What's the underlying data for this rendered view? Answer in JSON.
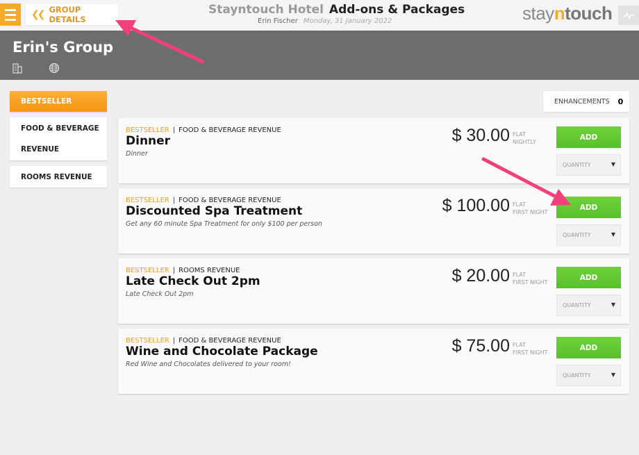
{
  "topbar": {
    "back_label": "GROUP DETAILS",
    "hotel_name": "Stayntouch Hotel",
    "page_title": "Add-ons & Packages",
    "user_name": "Erin Fischer",
    "date": "Monday, 31 January 2022",
    "logo": {
      "part1": "stay",
      "part2": "n",
      "part3": "touch"
    }
  },
  "header": {
    "group_name": "Erin's Group",
    "icons": [
      "building-icon",
      "globe-icon"
    ]
  },
  "sidebar": {
    "items": [
      {
        "label": "BESTSELLER",
        "active": true
      },
      {
        "label_line1": "FOOD & BEVERAGE",
        "label_line2": "REVENUE",
        "active": false
      },
      {
        "label": "ROOMS REVENUE",
        "active": false
      }
    ]
  },
  "enhancements": {
    "label": "ENHANCEMENTS",
    "count": "0"
  },
  "addons": [
    {
      "category": "BESTSELLER",
      "revenue": "FOOD & BEVERAGE REVENUE",
      "name": "Dinner",
      "description": "Dinner",
      "price": "$ 30.00",
      "price_type_1": "FLAT",
      "price_type_2": "NIGHTLY",
      "add_label": "ADD",
      "quantity_label": "QUANTITY"
    },
    {
      "category": "BESTSELLER",
      "revenue": "FOOD & BEVERAGE REVENUE",
      "name": "Discounted Spa Treatment",
      "description": "Get any 60 minute Spa Treatment for only $100 per person",
      "price": "$ 100.00",
      "price_type_1": "FLAT",
      "price_type_2": "FIRST NIGHT",
      "add_label": "ADD",
      "quantity_label": "QUANTITY"
    },
    {
      "category": "BESTSELLER",
      "revenue": "ROOMS REVENUE",
      "name": "Late Check Out 2pm",
      "description": "Late Check Out 2pm",
      "price": "$ 20.00",
      "price_type_1": "FLAT",
      "price_type_2": "FIRST NIGHT",
      "add_label": "ADD",
      "quantity_label": "QUANTITY"
    },
    {
      "category": "BESTSELLER",
      "revenue": "FOOD & BEVERAGE REVENUE",
      "name": "Wine and Chocolate Package",
      "description": "Red Wine and Chocolates delivered to your room!",
      "price": "$ 75.00",
      "price_type_1": "FLAT",
      "price_type_2": "FIRST NIGHT",
      "add_label": "ADD",
      "quantity_label": "QUANTITY"
    }
  ],
  "colors": {
    "accent_orange": "#f7a928",
    "add_green": "#5fc830",
    "header_gray": "#6d6d6d",
    "annotation_arrow": "#f2417a"
  }
}
